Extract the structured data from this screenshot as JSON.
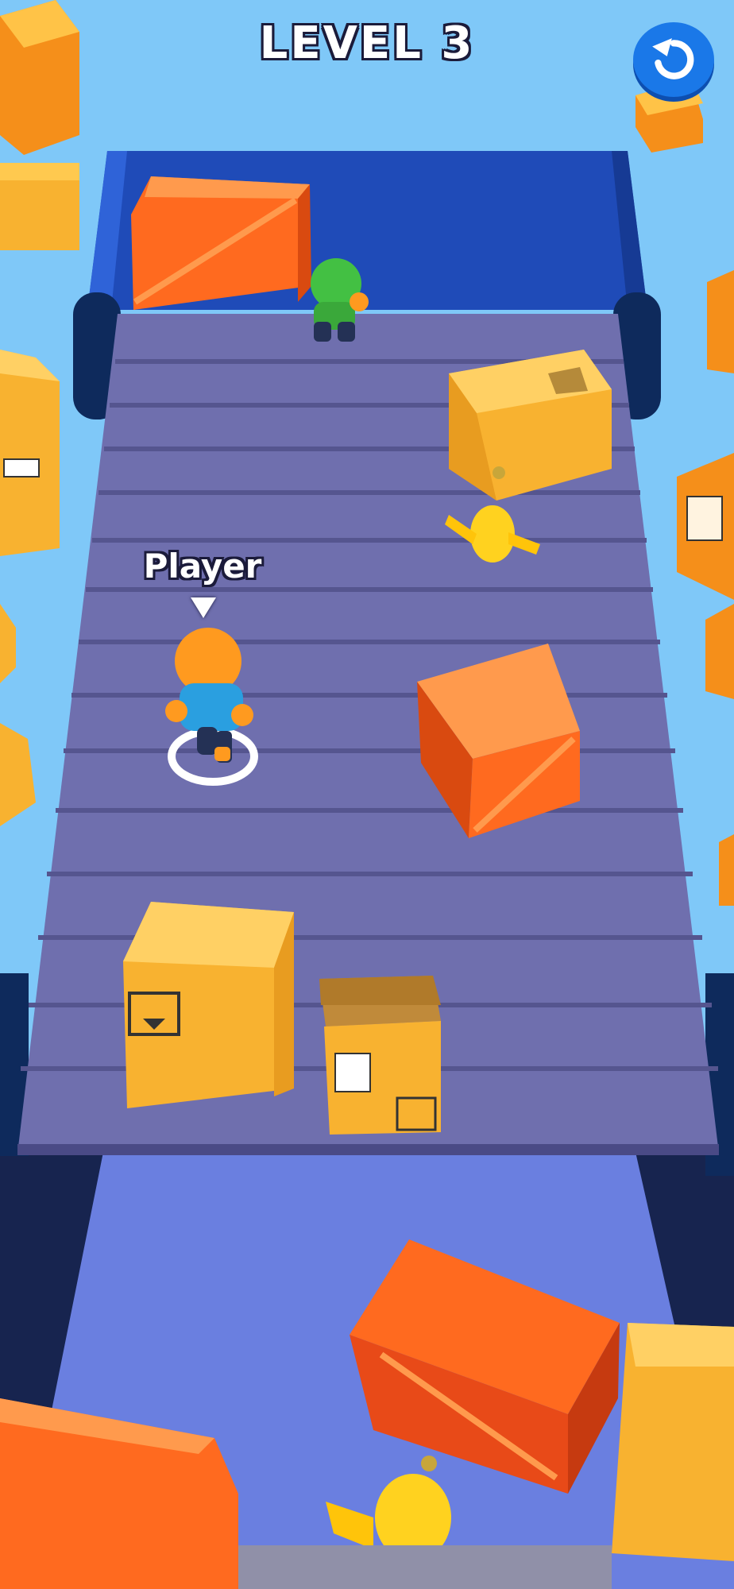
{
  "hud": {
    "level_label": "LEVEL 3",
    "restart_icon": "restart-icon"
  },
  "player": {
    "name_label": "Player"
  },
  "colors": {
    "sky": "#7fc8f8",
    "conveyor": "#6f6fae",
    "conveyor_wall": "#1f4bb8",
    "crate_orange": "#ff6a1f",
    "box_cardboard": "#f8b230",
    "accent_button": "#1a78e8"
  }
}
